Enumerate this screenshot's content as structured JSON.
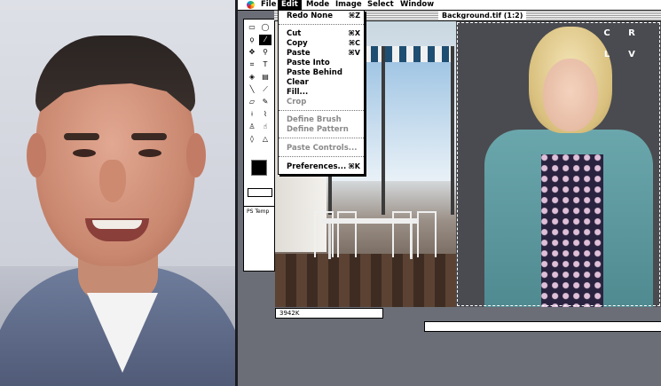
{
  "menubar": {
    "items": [
      "File",
      "Edit",
      "Mode",
      "Image",
      "Select",
      "Window"
    ]
  },
  "document": {
    "title": "Background.tif (1:2)",
    "status_size": "3942K"
  },
  "edit_menu": {
    "items": [
      {
        "label": "Redo None",
        "shortcut": "⌘Z",
        "enabled": true
      },
      {
        "label": "Cut",
        "shortcut": "⌘X",
        "enabled": true
      },
      {
        "label": "Copy",
        "shortcut": "⌘C",
        "enabled": true
      },
      {
        "label": "Paste",
        "shortcut": "⌘V",
        "enabled": true
      },
      {
        "label": "Paste Into",
        "shortcut": "",
        "enabled": true
      },
      {
        "label": "Paste Behind",
        "shortcut": "",
        "enabled": true
      },
      {
        "label": "Clear",
        "shortcut": "",
        "enabled": true
      },
      {
        "label": "Fill...",
        "shortcut": "",
        "enabled": true
      },
      {
        "label": "Crop",
        "shortcut": "",
        "enabled": false
      },
      {
        "label": "Define Brush",
        "shortcut": "",
        "enabled": false
      },
      {
        "label": "Define Pattern",
        "shortcut": "",
        "enabled": false
      },
      {
        "label": "Paste Controls...",
        "shortcut": "",
        "enabled": false
      },
      {
        "label": "Preferences...",
        "shortcut": "⌘K",
        "enabled": true
      }
    ]
  },
  "side_panel": {
    "label": "PS Temp"
  },
  "overlay_buttons": [
    "C",
    "R",
    "L",
    "V"
  ],
  "colors": {
    "menu_highlight": "#000000",
    "foreground_swatch": "#000000"
  }
}
